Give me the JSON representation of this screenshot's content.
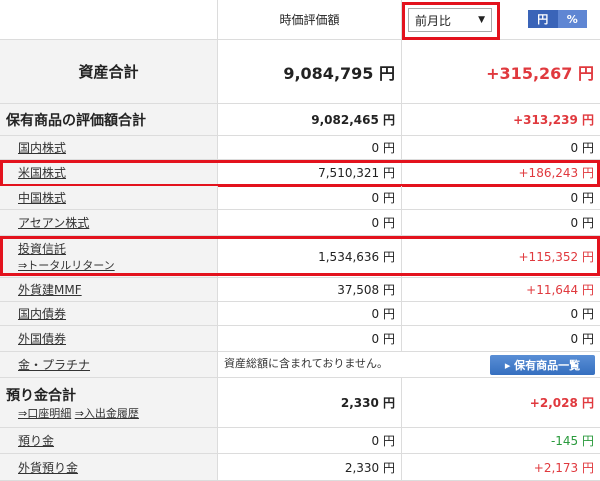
{
  "header": {
    "col_value": "時価評価額",
    "compare_select": "前月比",
    "toggle_yen": "円",
    "toggle_pct": "%"
  },
  "total": {
    "label": "資産合計",
    "value": "9,084,795 円",
    "change": "+315,267 円"
  },
  "holdings": {
    "label": "保有商品の評価額合計",
    "value": "9,082,465 円",
    "change": "+313,239 円"
  },
  "rows": [
    {
      "label": "国内株式",
      "value": "0 円",
      "change": "0 円"
    },
    {
      "label": "米国株式",
      "value": "7,510,321 円",
      "change": "+186,243 円"
    },
    {
      "label": "中国株式",
      "value": "0 円",
      "change": "0 円"
    },
    {
      "label": "アセアン株式",
      "value": "0 円",
      "change": "0 円"
    },
    {
      "label": "投資信託",
      "sublabel": "⇒トータルリターン",
      "value": "1,534,636 円",
      "change": "+115,352 円"
    },
    {
      "label": "外貨建MMF",
      "value": "37,508 円",
      "change": "+11,644 円"
    },
    {
      "label": "国内債券",
      "value": "0 円",
      "change": "0 円"
    },
    {
      "label": "外国債券",
      "value": "0 円",
      "change": "0 円"
    },
    {
      "label": "金・プラチナ",
      "notice": "資産総額に含まれておりません。",
      "button": "▸ 保有商品一覧"
    }
  ],
  "deposits": {
    "label": "預り金合計",
    "link1": "⇒口座明細",
    "link2": "⇒入出金履歴",
    "value": "2,330 円",
    "change": "+2,028 円"
  },
  "deposit_rows": [
    {
      "label": "預り金",
      "value": "0 円",
      "change": "-145 円"
    },
    {
      "label": "外貨預り金",
      "value": "2,330 円",
      "change": "+2,173 円"
    }
  ],
  "colors": {
    "positive": "#e0393e",
    "negative": "#2a9a3c",
    "highlight": "#e3121d",
    "accent": "#3a64b8"
  }
}
